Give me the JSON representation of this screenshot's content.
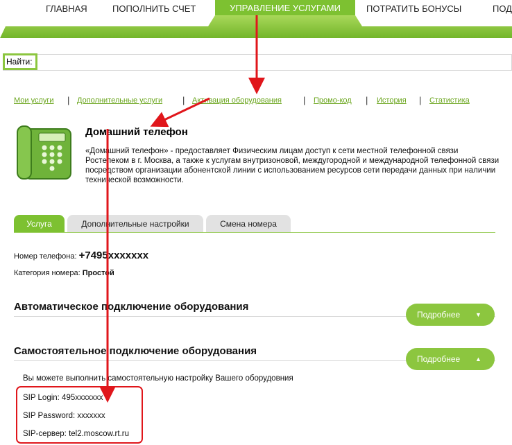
{
  "nav": {
    "items": [
      "ГЛАВНАЯ",
      "ПОПОЛНИТЬ СЧЕТ",
      "УПРАВЛЕНИЕ УСЛУГАМИ",
      "ПОТРАТИТЬ БОНУСЫ",
      "ПОД"
    ],
    "active_index": 2
  },
  "search": {
    "label": "Найти:",
    "value": ""
  },
  "subnav": [
    "Мои услуги",
    "Дополнительные услуги",
    "Активация оборудования",
    "Промо-код",
    "История",
    "Статистика"
  ],
  "service": {
    "icon": "telephone-icon",
    "title": "Домашний телефон",
    "description": "«Домашний телефон» - предоставляет Физическим лицам доступ к сети местной телефонной связи Ростелеком в г. Москва, а также к услугам внутризоновой, междугородной и международной телефонной связи посредством организации абонентской линии с использованием ресурсов сети передачи данных при наличии технической возможности."
  },
  "tabs": [
    "Услуга",
    "Дополнительные настройки",
    "Смена номера"
  ],
  "details": {
    "phone_label": "Номер телефона:",
    "phone_value": "+7495xxxxxxx",
    "category_label": "Категория номера:",
    "category_value": "Простой"
  },
  "sections": [
    {
      "title": "Автоматическое подключение оборудования",
      "button": "Подробнее",
      "icon": "chevron-down-icon"
    },
    {
      "title": "Самостоятельное подключение оборудования",
      "button": "Подробнее",
      "icon": "chevron-up-icon"
    }
  ],
  "manual_setup": {
    "intro": "Вы можете выполнить самостоятельную настройку Вашего оборудовния",
    "sip_login": "SIP Login: 495xxxxxxx",
    "sip_password": "SIP Password: xxxxxxx",
    "sip_server": "SIP-сервер: tel2.moscow.rt.ru"
  },
  "colors": {
    "accent": "#7dc131",
    "annotation": "#e0161b"
  }
}
